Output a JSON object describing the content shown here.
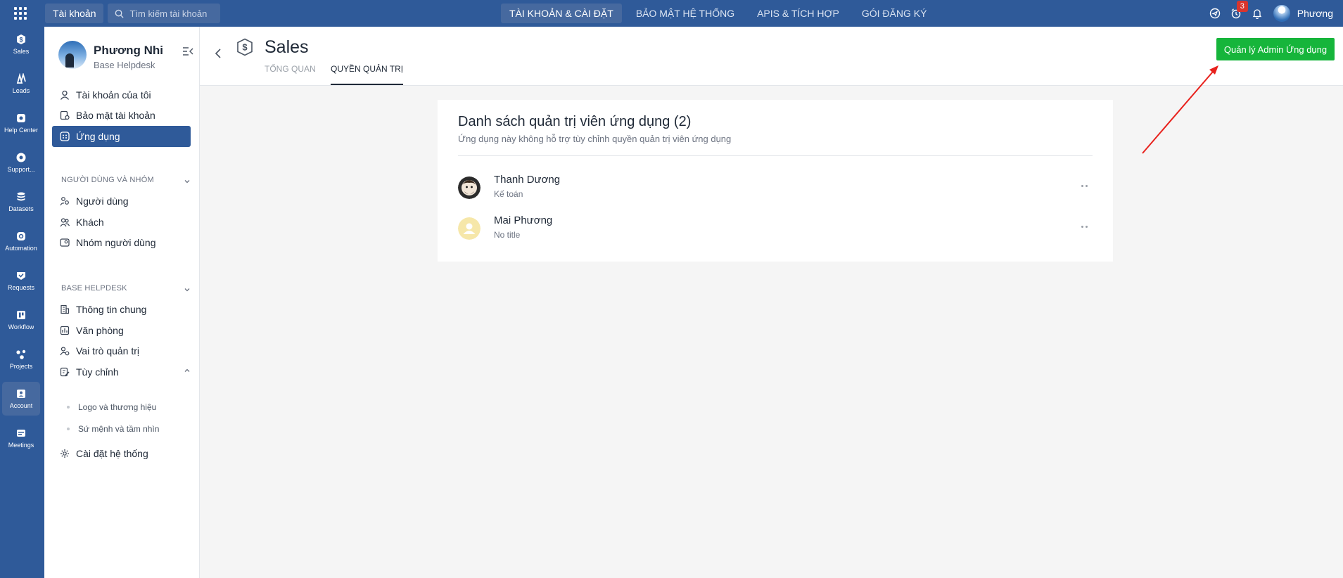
{
  "topbar": {
    "account_chip": "Tài khoản",
    "search_placeholder": "Tìm kiếm tài khoản",
    "nav": [
      "TÀI KHOẢN & CÀI ĐẶT",
      "BẢO MẬT HỆ THỐNG",
      "APIS & TÍCH HỢP",
      "GÓI ĐĂNG KÝ"
    ],
    "notification_count": "3",
    "user_name": "Phương"
  },
  "rail": {
    "items": [
      {
        "label": "Sales",
        "icon": "dollar-icon"
      },
      {
        "label": "Leads",
        "icon": "leads-icon"
      },
      {
        "label": "Help Center",
        "icon": "help-center-icon"
      },
      {
        "label": "Support...",
        "icon": "support-icon"
      },
      {
        "label": "Datasets",
        "icon": "database-icon"
      },
      {
        "label": "Automation",
        "icon": "automation-icon"
      },
      {
        "label": "Requests",
        "icon": "requests-icon"
      },
      {
        "label": "Workflow",
        "icon": "workflow-icon"
      },
      {
        "label": "Projects",
        "icon": "projects-icon"
      },
      {
        "label": "Account",
        "icon": "account-icon"
      },
      {
        "label": "Meetings",
        "icon": "meetings-icon"
      }
    ],
    "active": "Account"
  },
  "sidebar": {
    "profile_name": "Phương Nhi",
    "profile_sub": "Base Helpdesk",
    "account_items": [
      "Tài khoản của tôi",
      "Bảo mật tài khoản",
      "Ứng dụng"
    ],
    "section_users": "NGƯỜI DÙNG VÀ NHÓM",
    "user_items": [
      "Người dùng",
      "Khách",
      "Nhóm người dùng"
    ],
    "section_org": "BASE HELPDESK",
    "org_items": [
      "Thông tin chung",
      "Văn phòng",
      "Vai trò quản trị",
      "Tùy chỉnh"
    ],
    "custom_sub_items": [
      "Logo và thương hiệu",
      "Sứ mệnh và tầm nhìn"
    ],
    "system_settings": "Cài đặt hệ thống"
  },
  "header": {
    "title": "Sales",
    "tabs": [
      "TỔNG QUAN",
      "QUYỀN QUẢN TRỊ"
    ],
    "active_tab": "QUYỀN QUẢN TRỊ",
    "manage_button": "Quản lý Admin Ứng dụng"
  },
  "card": {
    "title": "Danh sách quản trị viên ứng dụng (2)",
    "subtitle": "Ứng dụng này không hỗ trợ tùy chỉnh quyền quản trị viên ứng dụng",
    "admins": [
      {
        "name": "Thanh Dương",
        "role": "Kế toán"
      },
      {
        "name": "Mai Phương",
        "role": "No title"
      }
    ]
  },
  "colors": {
    "brand_blue": "#2f5a99",
    "active_blue": "#46699f",
    "primary_green": "#16b53b",
    "badge_red": "#d8352e",
    "annotation_red": "#e8211c"
  }
}
